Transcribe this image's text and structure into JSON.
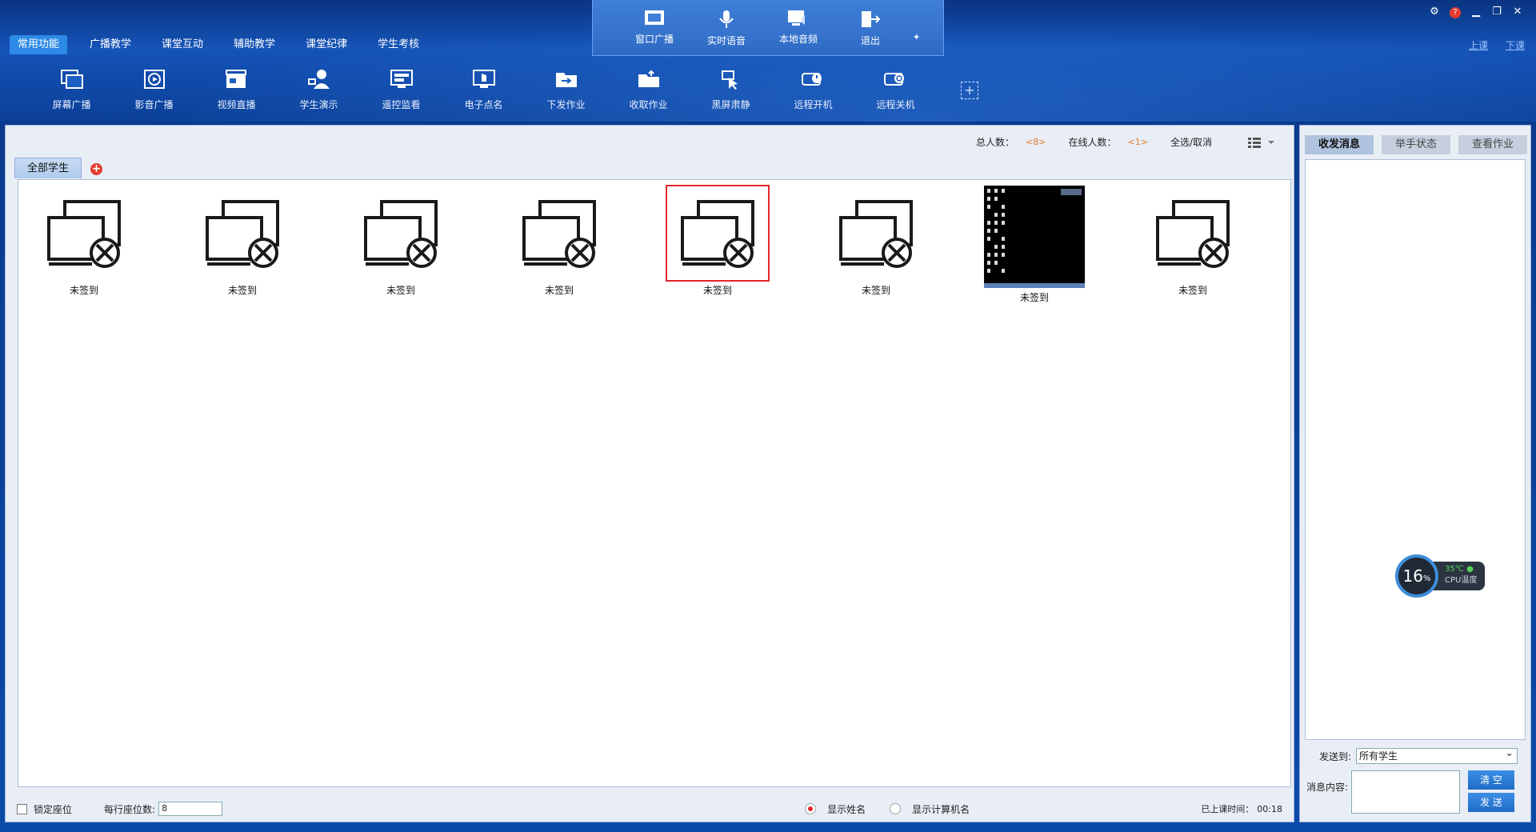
{
  "menu_tabs": [
    "常用功能",
    "广播教学",
    "课堂互动",
    "辅助教学",
    "课堂纪律",
    "学生考核"
  ],
  "toolbar": [
    {
      "label": "屏幕广播",
      "icon": "screen-broadcast-icon"
    },
    {
      "label": "影音广播",
      "icon": "video-broadcast-icon"
    },
    {
      "label": "视频直播",
      "icon": "live-video-icon"
    },
    {
      "label": "学生演示",
      "icon": "student-demo-icon"
    },
    {
      "label": "遥控监看",
      "icon": "remote-monitor-icon"
    },
    {
      "label": "电子点名",
      "icon": "roll-call-icon"
    },
    {
      "label": "下发作业",
      "icon": "send-homework-icon"
    },
    {
      "label": "收取作业",
      "icon": "collect-homework-icon"
    },
    {
      "label": "黑屏肃静",
      "icon": "black-screen-icon"
    },
    {
      "label": "远程开机",
      "icon": "remote-power-on-icon"
    },
    {
      "label": "远程关机",
      "icon": "remote-shutdown-icon"
    }
  ],
  "float_panel": [
    {
      "label": "窗口广播",
      "icon": "window-broadcast-icon"
    },
    {
      "label": "实时语音",
      "icon": "microphone-icon"
    },
    {
      "label": "本地音频",
      "icon": "local-audio-icon"
    },
    {
      "label": "退出",
      "icon": "exit-icon"
    }
  ],
  "class_links": {
    "start": "上课",
    "end": "下课"
  },
  "stats": {
    "total_label": "总人数：",
    "total_value": "<8>",
    "online_label": "在线人数：",
    "online_value": "<1>",
    "select_all": "全选/取消"
  },
  "group": {
    "label": "全部学生"
  },
  "seats": [
    {
      "name": "未签到",
      "status": "offline"
    },
    {
      "name": "未签到",
      "status": "offline"
    },
    {
      "name": "未签到",
      "status": "offline"
    },
    {
      "name": "未签到",
      "status": "offline"
    },
    {
      "name": "未签到",
      "status": "offline",
      "selected": true
    },
    {
      "name": "未签到",
      "status": "offline"
    },
    {
      "name": "未签到",
      "status": "online"
    },
    {
      "name": "未签到",
      "status": "offline"
    }
  ],
  "bottom": {
    "lock_seat": "锁定座位",
    "per_row_label": "每行座位数:",
    "per_row_value": "8",
    "show_name": "显示姓名",
    "show_computer": "显示计算机名",
    "elapsed_label": "已上课时间：",
    "elapsed_value": "00:18"
  },
  "side": {
    "tabs": [
      "收发消息",
      "举手状态",
      "查看作业"
    ],
    "send_to_label": "发送到:",
    "send_to_value": "所有学生",
    "content_label": "消息内容:",
    "clear_btn": "清 空",
    "send_btn": "发 送"
  },
  "cpu": {
    "usage": "16",
    "usage_unit": "%",
    "temp": "35℃",
    "label": "CPU温度"
  },
  "colors": {
    "accent": "#2d8ae6",
    "selected_border": "#e3262c",
    "count": "#e07a2a"
  }
}
